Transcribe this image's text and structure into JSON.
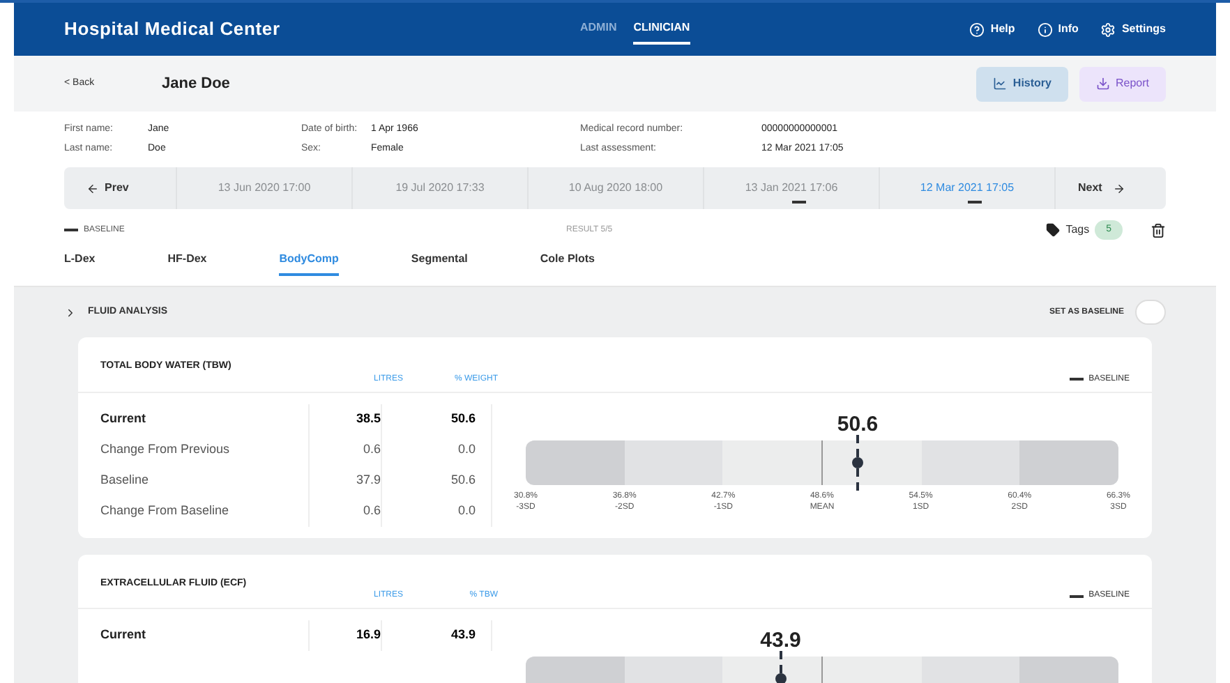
{
  "header": {
    "title": "Hospital Medical Center",
    "modes": [
      {
        "label": "ADMIN",
        "selected": false
      },
      {
        "label": "CLINICIAN",
        "selected": true
      }
    ],
    "links": [
      {
        "kind": "help",
        "label": "Help"
      },
      {
        "kind": "info",
        "label": "Info"
      },
      {
        "kind": "settings",
        "label": "Settings"
      }
    ]
  },
  "patient_bar": {
    "back": "< Back",
    "name": "Jane Doe",
    "history": "History",
    "report": "Report"
  },
  "details": [
    {
      "label": "First name:",
      "value": "Jane"
    },
    {
      "label": "Date of birth:",
      "value": "1 Apr 1966"
    },
    {
      "label": "Medical record number:",
      "value": "00000000000001"
    },
    {
      "label": "Last name:",
      "value": "Doe"
    },
    {
      "label": "Sex:",
      "value": "Female"
    },
    {
      "label": "Last assessment:",
      "value": "12 Mar 2021 17:05"
    }
  ],
  "timeline": {
    "prev": "Prev",
    "next": "Next",
    "items": [
      {
        "label": "13 Jun 2020 17:00",
        "selected": false,
        "mark": false
      },
      {
        "label": "19 Jul 2020 17:33",
        "selected": false,
        "mark": false
      },
      {
        "label": "10 Aug 2020 18:00",
        "selected": false,
        "mark": false
      },
      {
        "label": "13 Jan 2021 17:06",
        "selected": false,
        "mark": true
      },
      {
        "label": "12 Mar 2021 17:05",
        "selected": true,
        "mark": true
      }
    ]
  },
  "result_bar": {
    "baseline": "BASELINE",
    "result": "RESULT 5/5",
    "tags": "Tags",
    "tag_count": "5"
  },
  "tabs": [
    {
      "label": "L-Dex",
      "selected": false
    },
    {
      "label": "HF-Dex",
      "selected": false
    },
    {
      "label": "BodyComp",
      "selected": true
    },
    {
      "label": "Segmental",
      "selected": false
    },
    {
      "label": "Cole Plots",
      "selected": false
    }
  ],
  "section": {
    "title": "FLUID ANALYSIS",
    "expanded": false,
    "baseline_toggle": "SET AS BASELINE",
    "baseline_on": false
  },
  "cards": [
    {
      "title": "TOTAL BODY WATER (TBW)",
      "col_1": "LITRES",
      "col_2": "% WEIGHT",
      "legend": "BASELINE",
      "rows": [
        {
          "label": "Current",
          "v1": "38.5",
          "v2": "50.6"
        },
        {
          "label": "Change From Previous",
          "v1": "0.6",
          "v2": "0.0"
        },
        {
          "label": "Baseline",
          "v1": "37.9",
          "v2": "50.6"
        },
        {
          "label": "Change From Baseline",
          "v1": "0.6",
          "v2": "0.0"
        }
      ],
      "gauge": {
        "value": "50.6",
        "level": 0.56,
        "ticks": [
          {
            "pct": "30.8%",
            "sd": "-3SD"
          },
          {
            "pct": "36.8%",
            "sd": "-2SD"
          },
          {
            "pct": "42.7%",
            "sd": "-1SD"
          },
          {
            "pct": "48.6%",
            "sd": "MEAN"
          },
          {
            "pct": "54.5%",
            "sd": "1SD"
          },
          {
            "pct": "60.4%",
            "sd": "2SD"
          },
          {
            "pct": "66.3%",
            "sd": "3SD"
          }
        ]
      }
    },
    {
      "title": "EXTRACELLULAR FLUID (ECF)",
      "col_1": "LITRES",
      "col_2": "% TBW",
      "legend": "BASELINE",
      "rows": [
        {
          "label": "Current",
          "v1": "16.9",
          "v2": "43.9"
        }
      ],
      "gauge": {
        "value": "43.9",
        "level": 0.43
      }
    }
  ]
}
